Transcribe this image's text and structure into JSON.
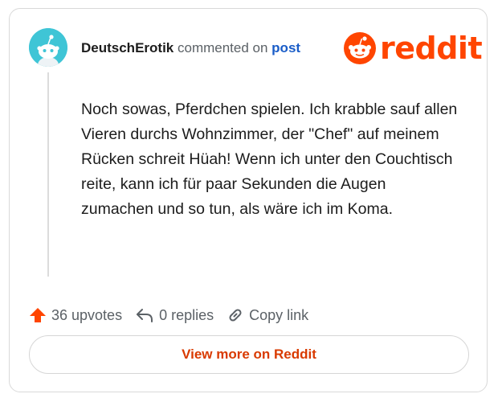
{
  "comment": {
    "username": "DeutschErotik",
    "commented_on": "commented on",
    "post_label": "post",
    "body": "Noch sowas, Pferdchen spielen. Ich krabble sauf allen Vieren durchs Wohnzimmer, der \"Chef\" auf meinem Rücken schreit Hüah! Wenn ich unter den Couchtisch reite, kann ich für paar Sekunden die Augen zumachen und so tun, als wäre ich im Koma."
  },
  "logo": {
    "word": "reddit",
    "icon": "reddit-logo-icon"
  },
  "actions": {
    "upvotes": "36 upvotes",
    "replies": "0 replies",
    "copy_link": "Copy link"
  },
  "view_more_label": "View more on Reddit",
  "colors": {
    "brand": "#ff4500",
    "link": "#1a5dc8",
    "avatar_bg": "#3fc5d6"
  }
}
